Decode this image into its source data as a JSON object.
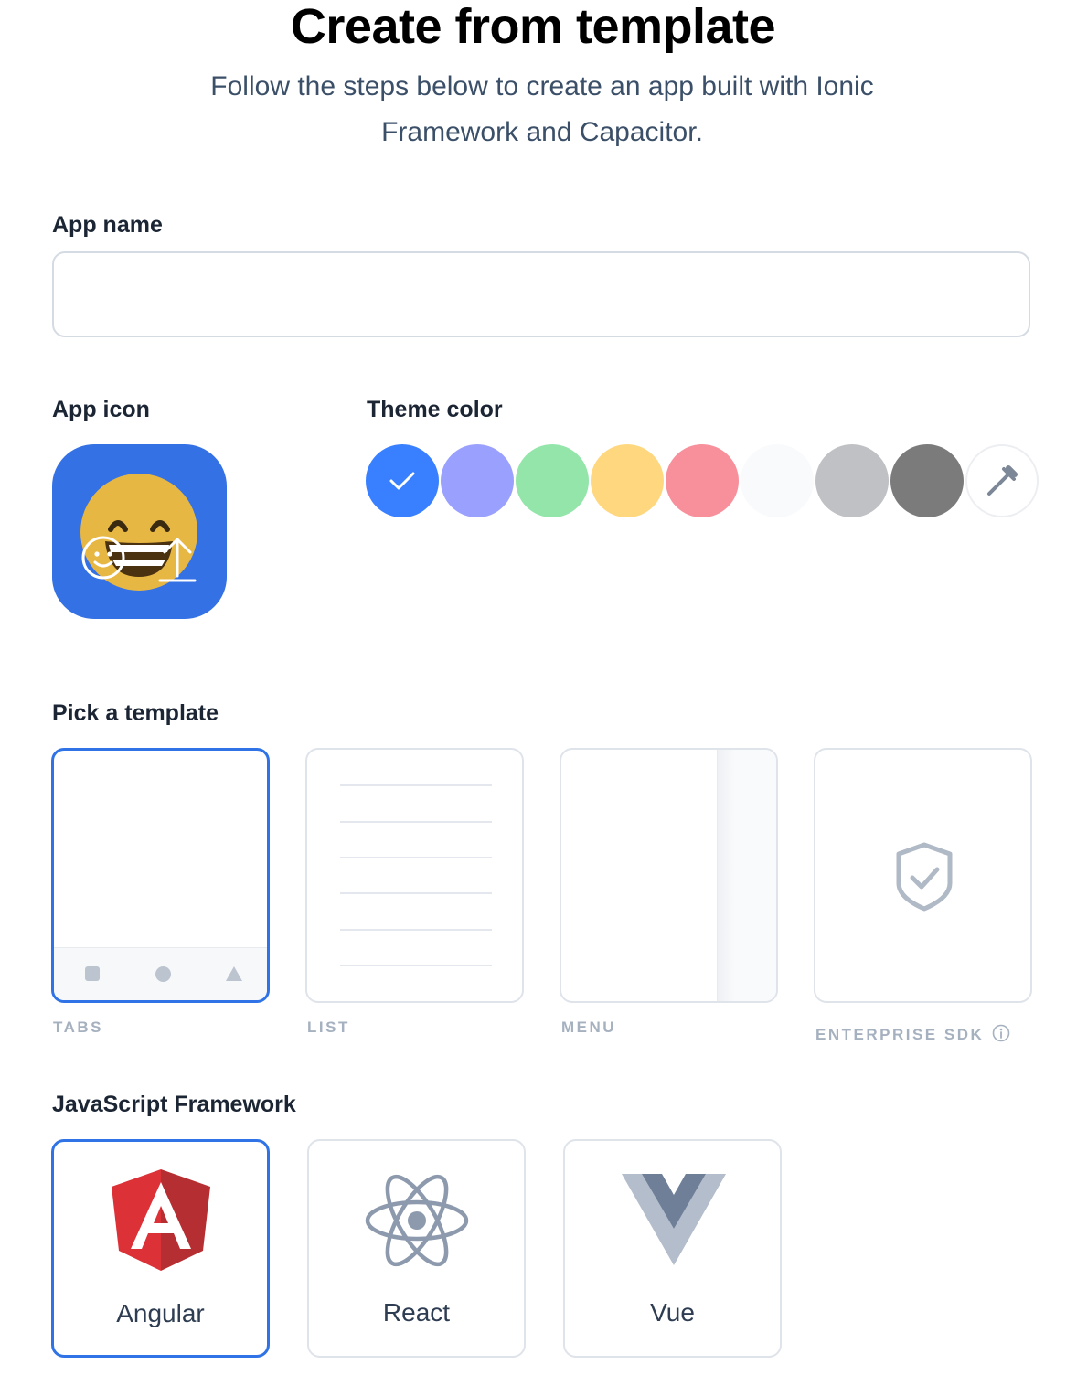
{
  "header": {
    "title": "Create from template",
    "subtitle_line1": "Follow the steps below to create an app built with Ionic",
    "subtitle_line2": "Framework and Capacitor."
  },
  "app_name": {
    "label": "App name",
    "value": "",
    "placeholder": ""
  },
  "app_icon": {
    "label": "App icon",
    "background": "#3371e4",
    "emoji": "grinning-squinting-face",
    "overlay_icons": [
      "emoji-picker-icon",
      "upload-icon"
    ]
  },
  "theme_color": {
    "label": "Theme color",
    "selected": "#3880ff",
    "swatches": [
      "#3880ff",
      "#9aa0fe",
      "#93e5aa",
      "#ffd77f",
      "#f7909b",
      "#f9fafb",
      "#c0c1c5",
      "#7b7b7b"
    ],
    "custom_icon": "eyedropper-icon"
  },
  "template": {
    "label": "Pick a template",
    "selected": "tabs",
    "options": [
      {
        "id": "tabs",
        "label": "TABS"
      },
      {
        "id": "list",
        "label": "LIST"
      },
      {
        "id": "menu",
        "label": "MENU"
      },
      {
        "id": "enterprise",
        "label": "ENTERPRISE SDK"
      }
    ]
  },
  "framework": {
    "label": "JavaScript Framework",
    "selected": "angular",
    "options": [
      {
        "id": "angular",
        "label": "Angular"
      },
      {
        "id": "react",
        "label": "React"
      },
      {
        "id": "vue",
        "label": "Vue"
      }
    ]
  },
  "colors": {
    "accent": "#2f73e6",
    "border": "#dfe3ea",
    "muted_label": "#a6b1c0"
  }
}
